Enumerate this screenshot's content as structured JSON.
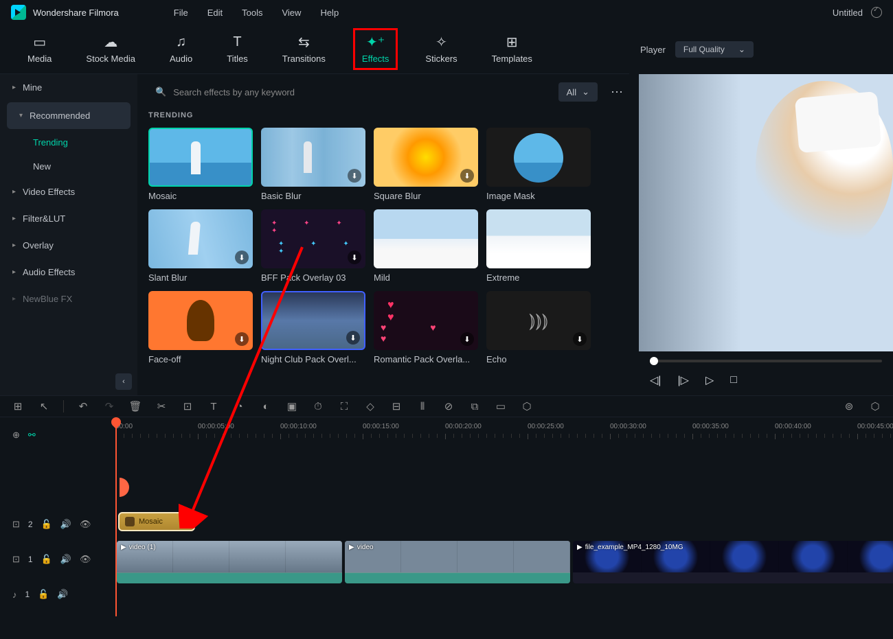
{
  "app": {
    "name": "Wondershare Filmora",
    "project": "Untitled"
  },
  "menu": [
    "File",
    "Edit",
    "Tools",
    "View",
    "Help"
  ],
  "tabs": [
    {
      "label": "Media",
      "icon": "⧉"
    },
    {
      "label": "Stock Media",
      "icon": "☁"
    },
    {
      "label": "Audio",
      "icon": "♫"
    },
    {
      "label": "Titles",
      "icon": "T"
    },
    {
      "label": "Transitions",
      "icon": "⇄"
    },
    {
      "label": "Effects",
      "icon": "✦",
      "active": true
    },
    {
      "label": "Stickers",
      "icon": "✧"
    },
    {
      "label": "Templates",
      "icon": "⊞"
    }
  ],
  "sidebar": {
    "items": [
      {
        "label": "Mine",
        "chev": "▸"
      },
      {
        "label": "Recommended",
        "chev": "▾",
        "selected": true
      },
      {
        "label": "Video Effects",
        "chev": "▸"
      },
      {
        "label": "Filter&LUT",
        "chev": "▸"
      },
      {
        "label": "Overlay",
        "chev": "▸"
      },
      {
        "label": "Audio Effects",
        "chev": "▸"
      },
      {
        "label": "NewBlue FX",
        "chev": "▸"
      }
    ],
    "subs": [
      {
        "label": "Trending",
        "active": true
      },
      {
        "label": "New"
      }
    ]
  },
  "search": {
    "placeholder": "Search effects by any keyword"
  },
  "filter": {
    "label": "All"
  },
  "section": "TRENDING",
  "effects": [
    {
      "label": "Mosaic",
      "cls": "t-mosaic",
      "selected": true,
      "dl": false
    },
    {
      "label": "Basic Blur",
      "cls": "t-blur",
      "dl": true
    },
    {
      "label": "Square Blur",
      "cls": "t-square",
      "dl": true
    },
    {
      "label": "Image Mask",
      "cls": "t-mask",
      "dl": false
    },
    {
      "label": "Slant Blur",
      "cls": "t-slant",
      "dl": true
    },
    {
      "label": "BFF Pack Overlay 03",
      "cls": "t-confetti",
      "dl": true
    },
    {
      "label": "Mild",
      "cls": "t-mild",
      "dl": false
    },
    {
      "label": "Extreme",
      "cls": "t-extreme",
      "dl": false
    },
    {
      "label": "Face-off",
      "cls": "t-face",
      "dl": true
    },
    {
      "label": "Night Club Pack Overl...",
      "cls": "t-night",
      "dl": true
    },
    {
      "label": "Romantic Pack Overla...",
      "cls": "t-romantic",
      "dl": true
    },
    {
      "label": "Echo",
      "cls": "t-echo",
      "dl": true
    }
  ],
  "player": {
    "label": "Player",
    "quality": "Full Quality"
  },
  "ruler": [
    "00:00",
    "00:00:05:00",
    "00:00:10:00",
    "00:00:15:00",
    "00:00:20:00",
    "00:00:25:00",
    "00:00:30:00",
    "00:00:35:00",
    "00:00:40:00",
    "00:00:45:00"
  ],
  "tracks": {
    "effect": {
      "num": "2",
      "clip": "Mosaic"
    },
    "video": {
      "num": "1",
      "clips": [
        {
          "label": "video (1)"
        },
        {
          "label": "video"
        },
        {
          "label": "file_example_MP4_1280_10MG"
        }
      ]
    },
    "audio": {
      "num": "1"
    }
  }
}
